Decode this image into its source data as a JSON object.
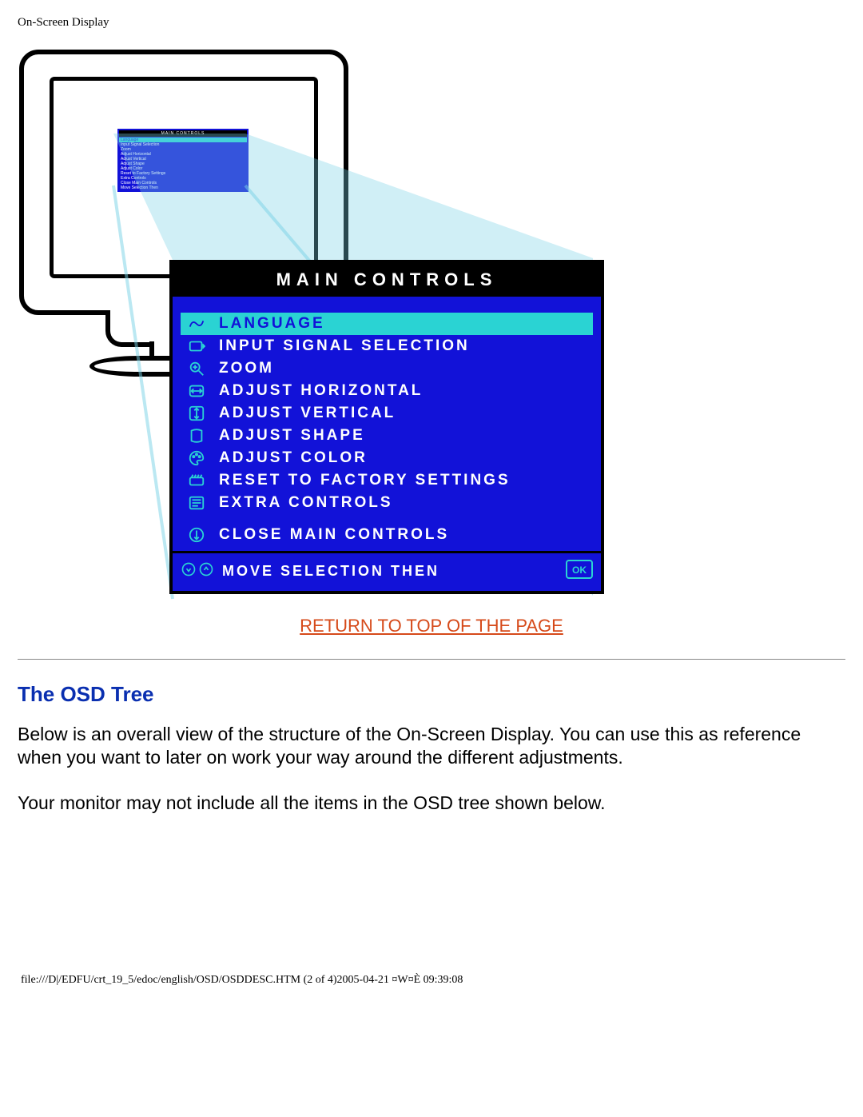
{
  "header_label": "On-Screen Display",
  "osd": {
    "title": "MAIN CONTROLS",
    "items": [
      {
        "icon": "language-icon",
        "label": "Language",
        "selected": true
      },
      {
        "icon": "input-icon",
        "label": "Input Signal Selection",
        "selected": false
      },
      {
        "icon": "zoom-icon",
        "label": "Zoom",
        "selected": false
      },
      {
        "icon": "adjust-h-icon",
        "label": "Adjust Horizontal",
        "selected": false
      },
      {
        "icon": "adjust-v-icon",
        "label": "Adjust Vertical",
        "selected": false
      },
      {
        "icon": "adjust-shape-icon",
        "label": "Adjust Shape",
        "selected": false
      },
      {
        "icon": "adjust-color-icon",
        "label": "Adjust Color",
        "selected": false
      },
      {
        "icon": "reset-icon",
        "label": "Reset to Factory Settings",
        "selected": false
      },
      {
        "icon": "extra-icon",
        "label": "Extra Controls",
        "selected": false
      }
    ],
    "close_item": {
      "icon": "close-icon",
      "label": "Close Main Controls"
    },
    "footer": {
      "label": "Move Selection Then",
      "arrows_icon": "up-down-icon",
      "ok_icon": "ok-icon"
    }
  },
  "return_link": "RETURN TO TOP OF THE PAGE",
  "section_heading": "The OSD Tree",
  "paragraph1": "Below is an overall view of the structure of the On-Screen Display. You can use this as reference when you want to later on work your way around the different adjustments.",
  "paragraph2": "Your monitor may not include all the items in the OSD tree shown below.",
  "footer_path": "file:///D|/EDFU/crt_19_5/edoc/english/OSD/OSDDESC.HTM (2 of 4)2005-04-21 ¤W¤È 09:39:08"
}
